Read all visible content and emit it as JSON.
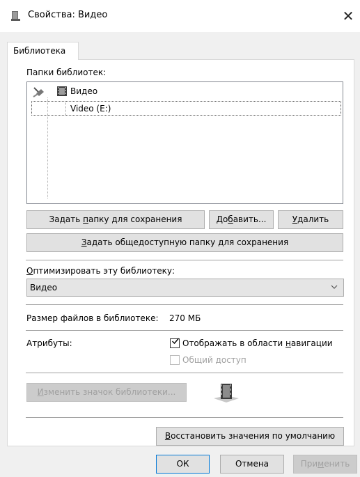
{
  "window": {
    "title": "Свойства: Видео",
    "close_glyph": "✕"
  },
  "tab": {
    "label": "Библиотека"
  },
  "folders": {
    "label": "Папки библиотек:",
    "root_label": "Видео",
    "child_label": "Video (E:)"
  },
  "buttons": {
    "set_save_folder_pre": "Задать ",
    "set_save_folder_ul": "п",
    "set_save_folder_post": "апку для сохранения",
    "add_pre": "До",
    "add_ul": "б",
    "add_post": "авить...",
    "remove_ul": "У",
    "remove_post": "далить",
    "set_public_ul": "З",
    "set_public_post": "адать общедоступную папку для сохранения",
    "change_icon_ul": "И",
    "change_icon_post": "зменить значок библиотеки...",
    "restore_ul": "В",
    "restore_post": "осстановить значения по умолчанию",
    "ok": "ОК",
    "cancel": "Отмена",
    "apply_pre": "При",
    "apply_ul": "м",
    "apply_post": "енить"
  },
  "optimize": {
    "label_ul": "О",
    "label_post": "птимизировать эту библиотеку:",
    "selected": "Видео"
  },
  "size": {
    "label": "Размер файлов в библиотеке:",
    "value": "270 МБ"
  },
  "attributes": {
    "label": "Атрибуты:",
    "show_nav_pre": "Отображать в области ",
    "show_nav_ul": "н",
    "show_nav_post": "авигации",
    "show_nav_checked": true,
    "shared_label": "Общий доступ",
    "shared_checked": false
  }
}
